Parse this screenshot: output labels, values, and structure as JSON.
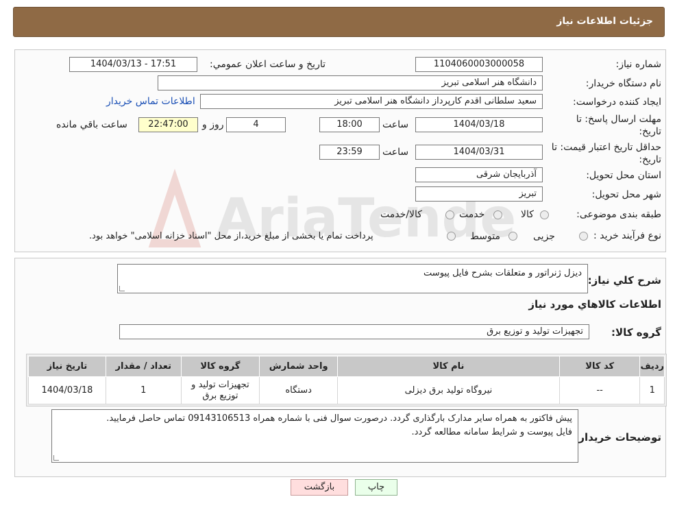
{
  "header": {
    "title": "جزئیات اطلاعات نیاز"
  },
  "fields": {
    "need_number_label": "شماره نیاز:",
    "need_number": "1104060003000058",
    "announce_label": "تاریخ و ساعت اعلان عمومي:",
    "announce_value": "1404/03/13 - 17:51",
    "buyer_org_label": "نام دستگاه خریدار:",
    "buyer_org": "دانشگاه هنر اسلامی تبریز",
    "requester_label": "ایجاد کننده درخواست:",
    "requester": "سعید سلطانی اقدم کارپرداز دانشگاه هنر اسلامی تبریز",
    "contact_link": "اطلاعات تماس خریدار",
    "reply_deadline_label_1": "مهلت ارسال پاسخ: تا",
    "reply_deadline_label_2": "تاریخ:",
    "reply_date": "1404/03/18",
    "time_label": "ساعت",
    "reply_time": "18:00",
    "days_value": "4",
    "days_label": "روز و",
    "remaining_time": "22:47:00",
    "remaining_label": "ساعت باقي مانده",
    "min_validity_label_1": "حداقل تاریخ اعتبار قیمت: تا",
    "min_validity_label_2": "تاریخ:",
    "validity_date": "1404/03/31",
    "validity_time": "23:59",
    "province_label": "استان محل تحویل:",
    "province": "آذربایجان شرقی",
    "city_label": "شهر محل تحویل:",
    "city": "تبریز",
    "category_label": "طبقه بندی موضوعی:",
    "category_options": [
      "کالا",
      "خدمت",
      "کالا/خدمت"
    ],
    "process_label": "نوع فرآیند خرید :",
    "process_options": [
      "جزیی",
      "متوسط"
    ],
    "payment_note": "پرداخت تمام یا بخشی از مبلغ خرید،از محل \"اسناد خزانه اسلامی\" خواهد بود."
  },
  "summary": {
    "general_desc_label": "شرح کلي نیاز:",
    "general_desc": "دیزل ژنراتور و متعلقات بشرح فایل پیوست",
    "goods_info_title": "اطلاعات کالاهاي مورد نیاز",
    "goods_group_label": "گروه کالا:",
    "goods_group": "تجهیزات تولید و توزیع برق"
  },
  "table": {
    "headers": [
      "ردیف",
      "کد کالا",
      "نام کالا",
      "واحد شمارش",
      "گروه کالا",
      "تعداد / مقدار",
      "تاریخ نیاز"
    ],
    "rows": [
      [
        "1",
        "--",
        "نیروگاه تولید برق دیزلی",
        "دستگاه",
        "تجهیزات تولید و توزیع برق",
        "1",
        "1404/03/18"
      ]
    ]
  },
  "buyer_notes": {
    "label": "توضیحات خریدار:",
    "line1": "پیش فاکتور به همراه سایر مدارک بارگذاری گردد. درصورت سوال فنی با شماره همراه 09143106513 تماس حاصل فرمایید.",
    "line2": "فایل پیوست و شرایط سامانه مطالعه گردد."
  },
  "buttons": {
    "print": "چاپ",
    "back": "بازگشت"
  },
  "watermark": {
    "text": "AriaTender.neT"
  },
  "colors": {
    "header_bg": "#8f6a45",
    "link": "#1a4fb5",
    "remaining_bg": "#ffffcc",
    "back_btn_bg": "#ffdede",
    "print_btn_bg": "#eaffea"
  }
}
